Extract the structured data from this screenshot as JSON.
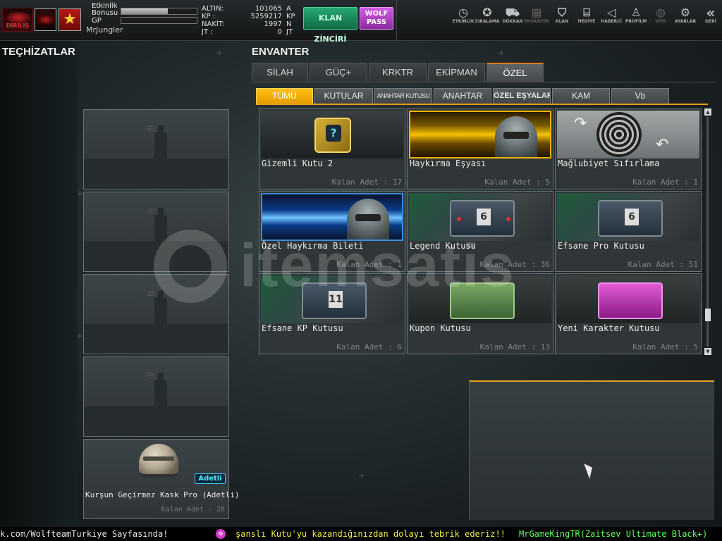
{
  "top": {
    "logo_text": "DİRİLİŞ",
    "etkinlik_label": "Etkinlik Bonusu",
    "etkinlik_progress": 0.62,
    "gp_label": "GP",
    "gp_progress": 0.0,
    "username": "MrJungler",
    "currency": [
      {
        "key": "ALTIN:",
        "value": "101065",
        "unit": "A"
      },
      {
        "key": "KP   :",
        "value": "5259217",
        "unit": "KP"
      },
      {
        "key": "NAKİT:",
        "value": "1997",
        "unit": "N"
      },
      {
        "key": "JT   :",
        "value": "0",
        "unit": "JT"
      }
    ],
    "klan_btn": "KLAN ZİNCİRİ",
    "wolf_btn": "WOLF PASS",
    "menu": [
      {
        "label": "ETKİNLİK",
        "icon": "stopwatch-icon",
        "glyph": "◷"
      },
      {
        "label": "SIRALAMA",
        "icon": "medal-icon",
        "glyph": "✪"
      },
      {
        "label": "DÜKKAN",
        "icon": "cart-icon",
        "glyph": "⛟"
      },
      {
        "label": "ENVANTER",
        "icon": "inventory-icon",
        "glyph": "▦"
      },
      {
        "label": "KLAN",
        "icon": "shield-icon",
        "glyph": "⛉"
      },
      {
        "label": "HEDİYE",
        "icon": "gift-icon",
        "glyph": "⌸"
      },
      {
        "label": "HABERCİ",
        "icon": "megaphone-icon",
        "glyph": "◁"
      },
      {
        "label": "PROFİLM",
        "icon": "profile-icon",
        "glyph": "♙"
      },
      {
        "label": "WEB",
        "icon": "globe-icon",
        "glyph": "◍"
      },
      {
        "label": "AYARLAR",
        "icon": "gear-icon",
        "glyph": "⚙"
      },
      {
        "label": "GERİ",
        "icon": "back-icon",
        "glyph": "«"
      }
    ]
  },
  "equipment": {
    "title": "TEÇHİZATLAR",
    "filled_item": {
      "name": "Kurşun Geçirmez Kask Pro (Adetli)",
      "badge": "Adetli",
      "count": "Kalan Adet : 28"
    }
  },
  "inventory": {
    "title": "ENVANTER",
    "tabs": [
      "SİLAH",
      "GÜÇ+",
      "KRKTR",
      "EKİPMAN",
      "ÖZEL"
    ],
    "active_tab": "ÖZEL",
    "subtabs": [
      "TÜMÜ",
      "KUTULAR",
      "ANAHTAR KUTUSU",
      "ANAHTAR",
      "ÖZEL EŞYALAR",
      "KAM",
      "Vb"
    ],
    "active_subtab": "TÜMÜ",
    "items": [
      {
        "name": "Gizemli Kutu 2",
        "count": "Kalan Adet : 17"
      },
      {
        "name": "Haykırma Eşyası",
        "count": "Kalan Adet : 5"
      },
      {
        "name": "Mağlubiyet  Sıfırlama",
        "count": "Kalan Adet : 1"
      },
      {
        "name": "Özel Haykırma Bileti",
        "count": "Kalan Adet : 1"
      },
      {
        "name": "Legend Kutusu",
        "count": "Kalan Adet : 36"
      },
      {
        "name": "Efsane Pro Kutusu",
        "count": "Kalan Adet : 51"
      },
      {
        "name": "Efsane KP Kutusu",
        "count": "Kalan Adet : 6"
      },
      {
        "name": "Kupon Kutusu",
        "count": "Kalan Adet : 13"
      },
      {
        "name": "Yeni Karakter Kutusu",
        "count": "Kalan Adet : 5"
      }
    ]
  },
  "ticker": {
    "left": "k.com/WolfteamTurkiye Sayfasında!",
    "middle": "şanslı Kutu'yu kazandığınızdan dolayı tebrik ederiz!!",
    "right": "MrGameKingTR(Zaitsev Ultimate Black+)"
  },
  "watermark": "itemsatis",
  "colors": {
    "accent": "#e89b00",
    "tab_accent": "#e07a20",
    "klan_green": "#1a8a5a",
    "wolf_purple": "#b047c8",
    "badge_cyan": "#55e3ff"
  }
}
